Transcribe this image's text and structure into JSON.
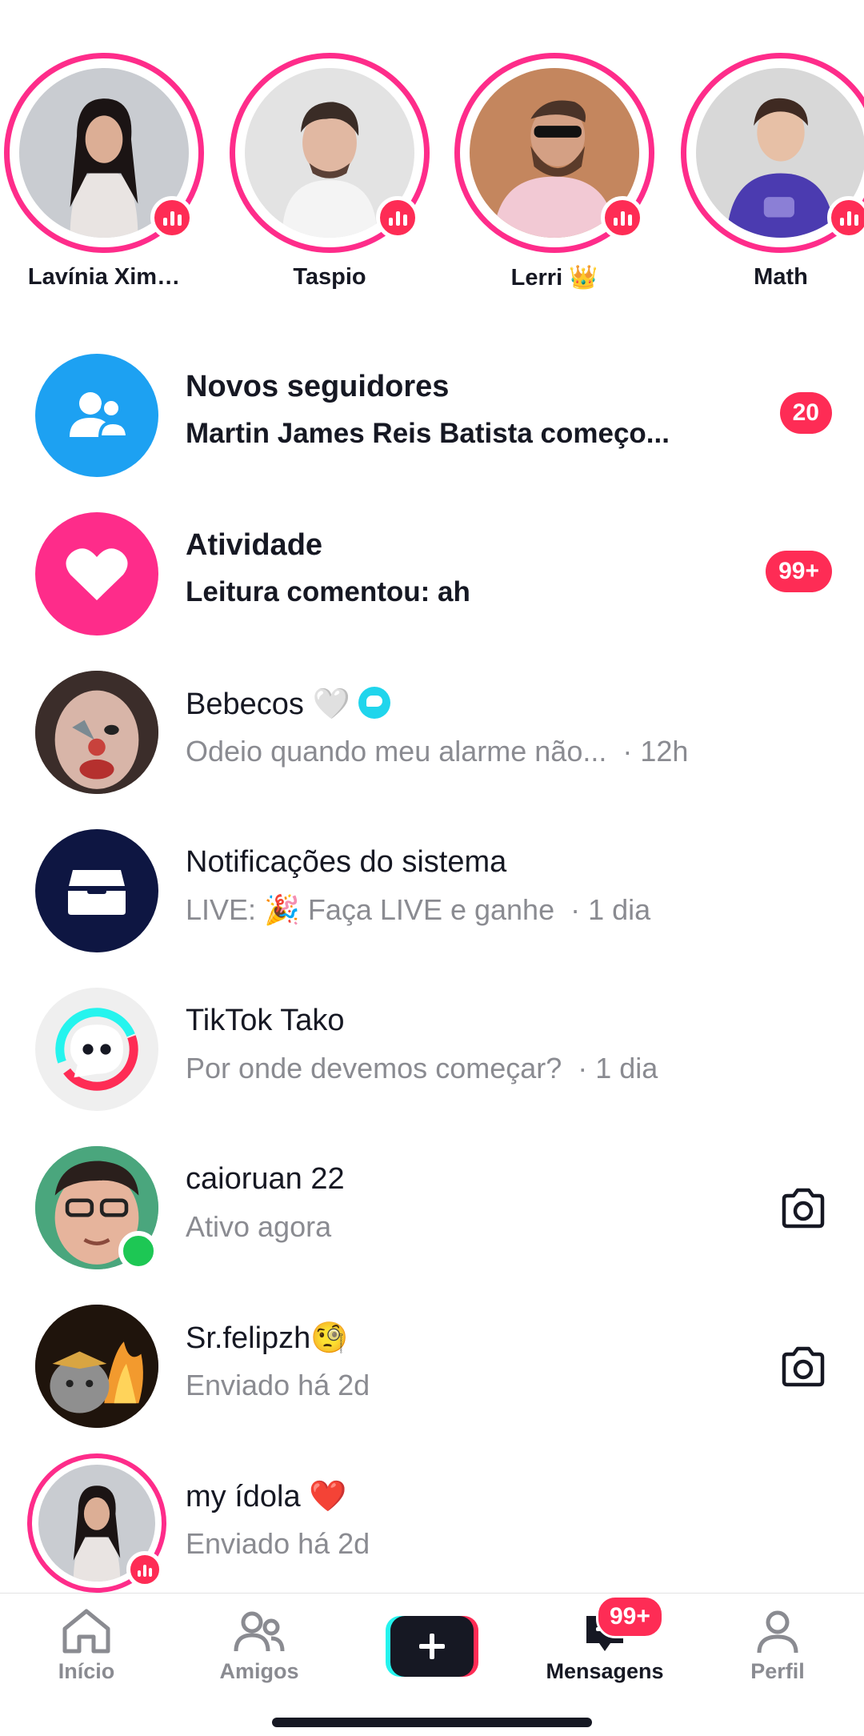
{
  "stories": [
    {
      "name": "Lavínia Xim…",
      "live": true
    },
    {
      "name": "Taspio",
      "live": true
    },
    {
      "name": "Lerri 👑",
      "live": true
    },
    {
      "name": "Math",
      "live": true
    }
  ],
  "inbox": {
    "new_followers": {
      "title": "Novos seguidores",
      "subtitle": "Martin James Reis Batista começo...",
      "badge": "20",
      "icon": "followers-icon",
      "color": "#1da1f2"
    },
    "activity": {
      "title": "Atividade",
      "subtitle": "Leitura comentou: ah",
      "badge": "99+",
      "icon": "heart-icon",
      "color": "#fe2c8a"
    },
    "chats": [
      {
        "name": "Bebecos 🤍",
        "preview": "Odeio quando meu alarme não...",
        "time": "· 12h"
      },
      {
        "name": "Notificações do sistema",
        "preview": "LIVE: 🎉 Faça LIVE e ganhe",
        "time": "· 1 dia"
      },
      {
        "name": "TikTok Tako",
        "preview": "Por onde devemos começar?",
        "time": "· 1 dia"
      },
      {
        "name": "caioruan 22",
        "preview": "Ativo agora",
        "time": ""
      },
      {
        "name": "Sr.felipzh🧐",
        "preview": "Enviado há 2d",
        "time": ""
      },
      {
        "name": "my ídola ❤️",
        "preview": "Enviado há 2d",
        "time": ""
      }
    ]
  },
  "nav": {
    "home": "Início",
    "friends": "Amigos",
    "messages": "Mensagens",
    "messages_badge": "99+",
    "profile": "Perfil"
  },
  "colors": {
    "accent": "#fe2c55",
    "story_ring": "#fe2c8a",
    "online": "#1dc754"
  }
}
